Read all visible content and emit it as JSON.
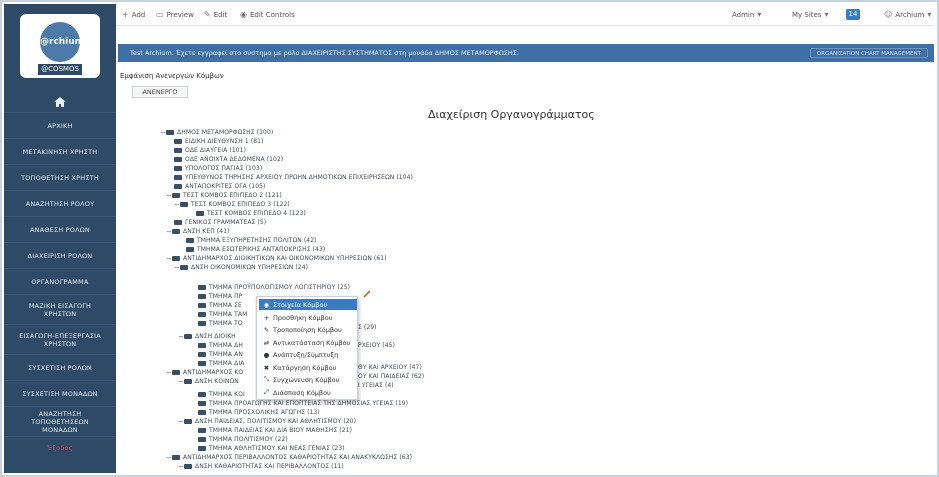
{
  "sidebar": {
    "logo_text": "@rchium",
    "logo_tag": "@COSMOS",
    "items": [
      {
        "label": "ΑΡΧΙΚΗ"
      },
      {
        "label": "ΜΕΤΑΚΙΝΗΣΗ ΧΡΗΣΤΗ"
      },
      {
        "label": "ΤΟΠΟΘΕΤΗΣΗ ΧΡΗΣΤΗ"
      },
      {
        "label": "ΑΝΑΖΗΤΗΣΗ ΡΟΛΟΥ"
      },
      {
        "label": "ΑΝΑΘΕΣΗ ΡΟΛΩΝ"
      },
      {
        "label": "ΔΙΑΧΕΙΡΙΣΗ ΡΟΛΩΝ"
      },
      {
        "label": "ΟΡΓΑΝΟΓΡΑΜΜΑ"
      },
      {
        "label": "ΜΑΖΙΚΗ ΕΙΣΑΓΩΓΗ ΧΡΗΣΤΩΝ"
      },
      {
        "label": "ΕΙΣΑΓΩΓΗ-ΕΠΕΞΕΡΓΑΣΙΑ ΧΡΗΣΤΩΝ"
      },
      {
        "label": "ΣΥΣΧΕΤΙΣΗ ΡΟΛΩΝ"
      },
      {
        "label": "ΣΥΣΧΕΤΙΣΗ ΜΟΝΑΔΩΝ"
      },
      {
        "label": "ΑΝΑΖΗΤΗΣΗ ΤΟΠΟΘΕΤΗΣΕΩΝ ΜΟΝΑΔΩΝ"
      },
      {
        "label": "Έξοδος"
      }
    ]
  },
  "toolbar": {
    "add": "Add",
    "preview": "Preview",
    "edit": "Edit",
    "edit_controls": "Edit Controls",
    "admin": "Admin",
    "my_sites": "My Sites",
    "badge": "14",
    "user": "Archium"
  },
  "infobar": {
    "text": "Test Archium. Έχετε εγγραφεί στο σύστημα με ρόλο ΔΙΑΧΕΙΡΙΣΤΗΣ ΣΥΣΤΗΜΑΤΟΣ στη μονάδα ΔΗΜΟΣ ΜΕΤΑΜΟΡΦΩΣΗΣ.",
    "button": "ORGANIZATION CHART MANAGEMENT"
  },
  "main": {
    "inactive_label": "Εμφάνιση Ανενεργών Κόμβων",
    "inactive_button": "ΑΝΕΝΕΡΓΟ",
    "page_title": "Διαχείριση Οργανογράμματος"
  },
  "tree": [
    {
      "toggle": "−",
      "label": "ΔΗΜΟΣ ΜΕΤΑΜΟΡΦΩΣΗΣ (100)"
    },
    {
      "toggle": "",
      "label": "ΕΙΔΙΚΗ ΔΙΕΥΘΥΝΣΗ 1 (81)"
    },
    {
      "toggle": "",
      "label": "ΟΔΕ ΔΙΑΥΓΕΙΑ (101)"
    },
    {
      "toggle": "",
      "label": "ΟΔΕ ΑΝΟΙΧΤΑ ΔΕΔΟΜΕΝΑ (102)"
    },
    {
      "toggle": "",
      "label": "ΥΠΟΛΟΓΟΣ ΠΑΓΙΑΣ (103)"
    },
    {
      "toggle": "",
      "label": "ΥΠΕΥΘΥΝΟΣ ΤΗΡΗΣΗΣ ΑΡΧΕΙΟΥ ΠΡΩΗΝ ΔΗΜΟΤΙΚΩΝ ΕΠΙΧΕΙΡΗΣΕΩΝ (104)"
    },
    {
      "toggle": "",
      "label": "ΑΝΤΑΠΟΚΡΙΤΕΣ ΟΓΑ (105)"
    },
    {
      "toggle": "−",
      "label": "ΤΕΣΤ ΚΟΜΒΟΣ ΕΠΙΠΕΔΟ 2 (121)"
    },
    {
      "toggle": "−",
      "label": "ΤΕΣΤ ΚΟΜΒΟΣ ΕΠΙΠΕΔΟ 3 (122)"
    },
    {
      "toggle": "",
      "label": "ΤΕΣΤ ΚΟΜΒΟΣ ΕΠΙΠΕΔΟ 4 (123)"
    },
    {
      "toggle": "",
      "label": "ΓΕΝΙΚΟΣ ΓΡΑΜΜΑΤΕΑΣ (5)"
    },
    {
      "toggle": "−",
      "label": "ΔΝΣΗ ΚΕΠ (41)"
    },
    {
      "toggle": "",
      "label": "ΤΜΗΜΑ ΕΞΥΠΗΡΕΤΗΣΗΣ ΠΟΛΙΤΩΝ (42)"
    },
    {
      "toggle": "",
      "label": "ΤΜΗΜΑ ΕΣΩΤΕΡΙΚΗΣ ΑΝΤΑΠΟΚΡΙΣΗΣ (43)"
    },
    {
      "toggle": "−",
      "label": "ΑΝΤΙΔΗΜΑΡΧΟΣ ΔΙΟΙΚΗΤΙΚΩΝ ΚΑΙ ΟΙΚΟΝΟΜΙΚΩΝ ΥΠΗΡΕΣΙΩΝ (61)"
    },
    {
      "toggle": "−",
      "label": "ΔΝΣΗ ΟΙΚΟΝΟΜΙΚΩΝ ΥΠΗΡΕΣΙΩΝ (24)"
    },
    {
      "toggle": "",
      "label": "ΤΜΗΜΑ ΠΡΟΫΠΟΛΟΓΙΣΜΟΥ ΛΟΓΙΣΤΗΡΙΟΥ (25)"
    },
    {
      "toggle": "",
      "label": "ΤΜΗΜΑ ΠΡ"
    },
    {
      "toggle": "",
      "label": "ΤΜΗΜΑ ΣΕ"
    },
    {
      "toggle": "",
      "label": "ΤΜΗΜΑ ΤΑΜ"
    },
    {
      "toggle": "",
      "label": "ΤΜΗΜΑ ΤΟ",
      "suffix": "Σ (29)"
    },
    {
      "toggle": "−",
      "label": "ΔΝΣΗ ΔΙΟΙΚΗ"
    },
    {
      "toggle": "",
      "label": "ΤΜΗΜΑ ΔΗ",
      "suffix": "ΡΧΕΙΟΥ (45)"
    },
    {
      "toggle": "",
      "label": "ΤΜΗΜΑ ΑΝ"
    },
    {
      "toggle": "",
      "label": "ΤΜΗΜΑ ΔΙΑ",
      "suffix": "ΘΥ ΚΑΙ ΑΡΧΕΙΟΥ (47)"
    },
    {
      "toggle": "−",
      "label": "ΑΝΤΙΔΗΜΑΡΧΟΣ ΚΟ",
      "suffix": "ΟΥ ΚΑΙ ΠΑΙΔΕΙΑΣ (62)"
    },
    {
      "toggle": "−",
      "label": "ΔΝΣΗ ΚΟΙΝΩΝ",
      "suffix": "Ι ΥΓΕΙΑΣ (4)"
    },
    {
      "toggle": "",
      "label": "ΤΜΗΜΑ ΚΟΙ"
    },
    {
      "toggle": "",
      "label": "ΤΜΗΜΑ ΠΡΟΑΓΩΓΗΣ ΚΑΙ ΕΠΟΠΤΕΙΑΣ ΤΗΣ ΔΗΜΟΣΙΑΣ ΥΓΕΙΑΣ (19)"
    },
    {
      "toggle": "",
      "label": "ΤΜΗΜΑ ΠΡΟΣΧΟΛΙΚΗΣ ΑΓΩΓΗΣ (13)"
    },
    {
      "toggle": "−",
      "label": "ΔΝΣΗ ΠΑΙΔΕΙΑΣ, ΠΟΛΙΤΙΣΜΟΥ ΚΑΙ ΑΘΛΗΤΙΣΜΟΥ (20)"
    },
    {
      "toggle": "",
      "label": "ΤΜΗΜΑ ΠΑΙΔΕΙΑΣ ΚΑΙ ΔΙΑ ΒΙΟΥ ΜΑΘΗΣΗΣ (21)"
    },
    {
      "toggle": "",
      "label": "ΤΜΗΜΑ ΠΟΛΙΤΙΣΜΟΥ (22)"
    },
    {
      "toggle": "",
      "label": "ΤΜΗΜΑ ΑΘΛΗΤΙΣΜΟΥ ΚΑΙ ΝΕΑΣ ΓΕΝΙΑΣ (23)"
    },
    {
      "toggle": "−",
      "label": "ΑΝΤΙΔΗΜΑΡΧΟΣ ΠΕΡΙΒΑΛΛΟΝΤΟΣ ΚΑΘΑΡΙΟΤΗΤΑΣ ΚΑΙ ΑΝΑΚΥΚΛΩΣΗΣ (63)"
    },
    {
      "toggle": "−",
      "label": "ΔΝΣΗ ΚΑΘΑΡΙΟΤΗΤΑΣ ΚΑΙ ΠΕΡΙΒΑΛΛΟΝΤΟΣ (11)"
    }
  ],
  "context_menu": [
    {
      "icon": "info-icon",
      "glyph": "◉",
      "label": "Στοιχεία Κόμβου"
    },
    {
      "icon": "plus-icon",
      "glyph": "+",
      "label": "Προσθήκη Κόμβου"
    },
    {
      "icon": "edit-icon",
      "glyph": "✎",
      "label": "Τροποποίηση Κόμβου"
    },
    {
      "icon": "replace-icon",
      "glyph": "⇄",
      "label": "Αντικατάσταση Κόμβου"
    },
    {
      "icon": "toggle-icon",
      "glyph": "●",
      "label": "Ανάπτυξη/Σύμπτυξη"
    },
    {
      "icon": "delete-icon",
      "glyph": "✖",
      "label": "Κατάργηση Κόμβου"
    },
    {
      "icon": "merge-icon",
      "glyph": "⤡",
      "label": "Συγχώνευση Κόμβου"
    },
    {
      "icon": "split-icon",
      "glyph": "⤢",
      "label": "Διάσπαση Κόμβου"
    }
  ],
  "colors": {
    "sidebar_bg": "#2f4a66",
    "infobar_bg": "#3e6fa6",
    "menu_selected": "#3a7cc2",
    "logout_text": "#d94a4a"
  }
}
